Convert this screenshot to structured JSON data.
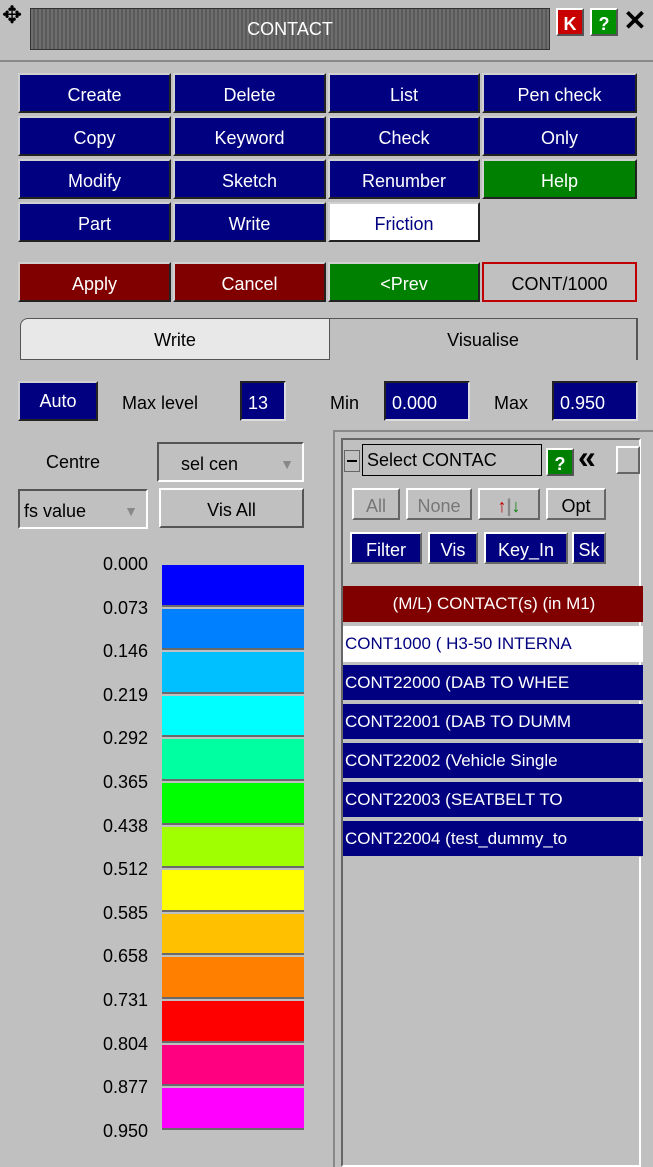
{
  "window": {
    "title": "CONTACT",
    "k_label": "K",
    "help_label": "?",
    "close_label": "✕"
  },
  "main_buttons": [
    {
      "label": "Create"
    },
    {
      "label": "Delete"
    },
    {
      "label": "List"
    },
    {
      "label": "Pen check"
    },
    {
      "label": "Copy"
    },
    {
      "label": "Keyword"
    },
    {
      "label": "Check"
    },
    {
      "label": "Only"
    },
    {
      "label": "Modify"
    },
    {
      "label": "Sketch"
    },
    {
      "label": "Renumber"
    },
    {
      "label": "Help"
    },
    {
      "label": "Part"
    },
    {
      "label": "Write"
    },
    {
      "label": "Friction"
    }
  ],
  "actions": {
    "apply": "Apply",
    "cancel": "Cancel",
    "prev": "<Prev",
    "current": "CONT/1000"
  },
  "tabs": {
    "write": "Write",
    "visualise": "Visualise"
  },
  "levels": {
    "auto": "Auto",
    "max_level_label": "Max level",
    "max_level_value": "13",
    "min_label": "Min",
    "min_value": "0.000",
    "max_label": "Max",
    "max_value": "0.950"
  },
  "controls": {
    "centre_label": "Centre",
    "centre_select": "sel cen",
    "value_select": "fs value",
    "vis_all": "Vis All"
  },
  "scale": {
    "labels": [
      "0.000",
      "0.073",
      "0.146",
      "0.219",
      "0.292",
      "0.365",
      "0.438",
      "0.512",
      "0.585",
      "0.658",
      "0.731",
      "0.804",
      "0.877",
      "0.950"
    ],
    "colors": [
      "#0000ff",
      "#0080ff",
      "#00c0ff",
      "#00ffff",
      "#00ffa0",
      "#00ff00",
      "#a0ff00",
      "#ffff00",
      "#ffc000",
      "#ff8000",
      "#ff0000",
      "#ff0080",
      "#ff00ff"
    ]
  },
  "selector": {
    "title": "Select CONTAC",
    "help": "?",
    "back": "«",
    "all": "All",
    "none": "None",
    "opt": "Opt",
    "filter": "Filter",
    "vis": "Vis",
    "key_in": "Key_In",
    "sk": "Sk",
    "header": "(M/L) CONTACT(s) (in M1)",
    "items": [
      "CONT1000 ( H3-50 INTERNA",
      "CONT22000 (DAB TO WHEE",
      "CONT22001 (DAB TO DUMM",
      "CONT22002 (Vehicle  Single",
      "CONT22003 (SEATBELT TO",
      "CONT22004 (test_dummy_to"
    ]
  }
}
